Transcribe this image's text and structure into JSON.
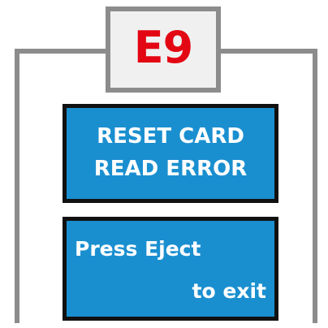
{
  "error": {
    "code": "E9",
    "code_color": "#e30613"
  },
  "screen1": {
    "line1": "RESET CARD",
    "line2": "READ ERROR"
  },
  "screen2": {
    "line1": "Press Eject",
    "line2": "to exit"
  },
  "colors": {
    "screen_bg": "#1a8fd0",
    "screen_text": "#ffffff",
    "frame": "#8c8c8c"
  }
}
